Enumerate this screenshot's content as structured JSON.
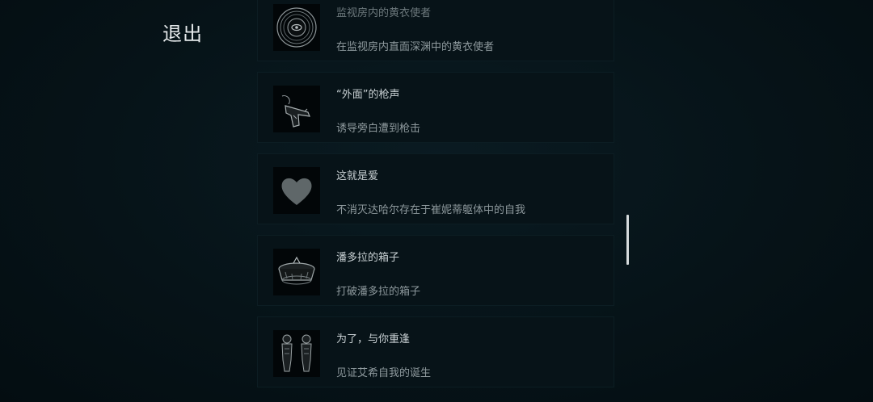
{
  "exit_label": "退出",
  "achievements": [
    {
      "title": "监视房内的黄衣使者",
      "desc": "在监视房内直面深渊中的黄衣使者",
      "icon": "watcher-eye-icon"
    },
    {
      "title": "“外面”的枪声",
      "desc": "诱导旁白遭到枪击",
      "icon": "pistol-icon"
    },
    {
      "title": "这就是爱",
      "desc": "不消灭达哈尔存在于崔妮蒂躯体中的自我",
      "icon": "heart-icon"
    },
    {
      "title": "潘多拉的箱子",
      "desc": "打破潘多拉的箱子",
      "icon": "pandora-box-icon"
    },
    {
      "title": "为了，与你重逢",
      "desc": "见证艾希自我的诞生",
      "icon": "twin-figures-icon"
    }
  ],
  "colors": {
    "background": "#061217",
    "card": "#071318",
    "title_text": "#c9d1d4",
    "desc_text": "#8e999d"
  }
}
